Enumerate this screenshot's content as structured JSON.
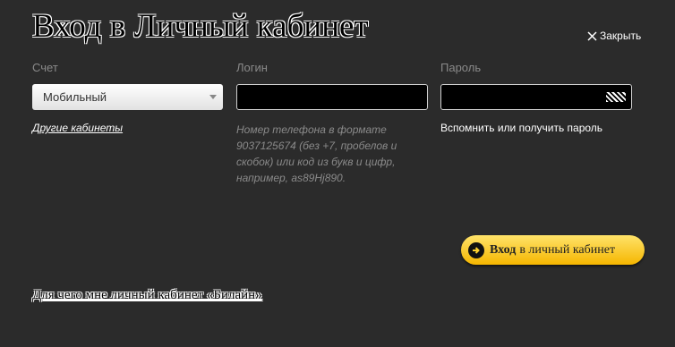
{
  "dialog": {
    "title": "Вход в Личный кабинет",
    "close_label": "Закрыть"
  },
  "form": {
    "account": {
      "label": "Счет",
      "selected": "Мобильный",
      "other_link": "Другие кабинеты"
    },
    "login": {
      "label": "Логин",
      "value": "",
      "hint": "Номер телефона в формате 9037125674 (без +7, пробелов и скобок) или код из букв и цифр, например, as89Hj890."
    },
    "password": {
      "label": "Пароль",
      "value": "",
      "recover_link": "Вспомнить или получить пароль"
    },
    "submit": {
      "bold": "Вход",
      "rest": "в личный кабинет"
    }
  },
  "footer": {
    "why_link": "Для чего мне личный кабинет «Билайн»"
  },
  "colors": {
    "background": "#2b2b2b",
    "button_yellow": "#f5b600"
  }
}
